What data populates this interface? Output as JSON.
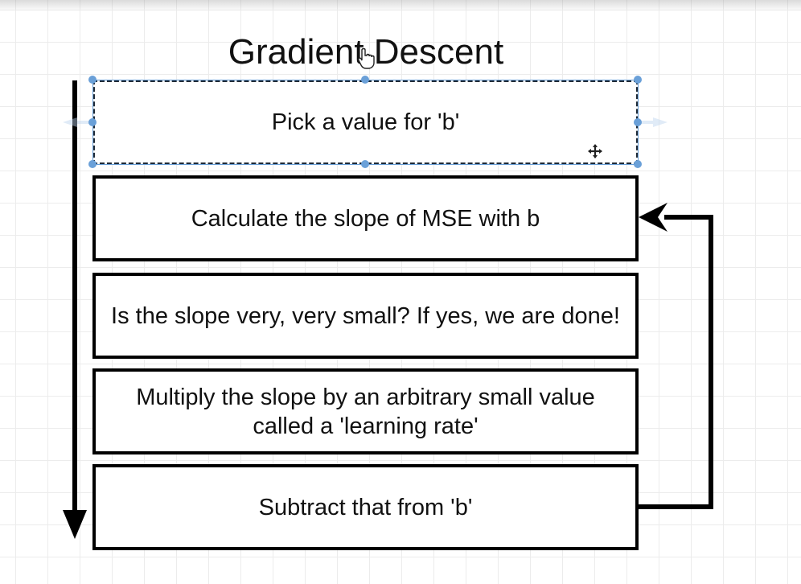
{
  "diagram": {
    "title": "Gradient Descent",
    "steps": [
      "Pick a value for 'b'",
      "Calculate the slope of MSE with b",
      "Is the slope very, very small?  If yes, we are done!",
      "Multiply the slope by an arbitrary small value called a 'learning rate'",
      "Subtract that from 'b'"
    ],
    "colors": {
      "ink": "#000000",
      "selection_handle": "#6aa0d8",
      "grid": "#ececec"
    },
    "icons": {
      "cursor": "pointer-hand-icon",
      "move": "move-crosshair-icon"
    }
  }
}
